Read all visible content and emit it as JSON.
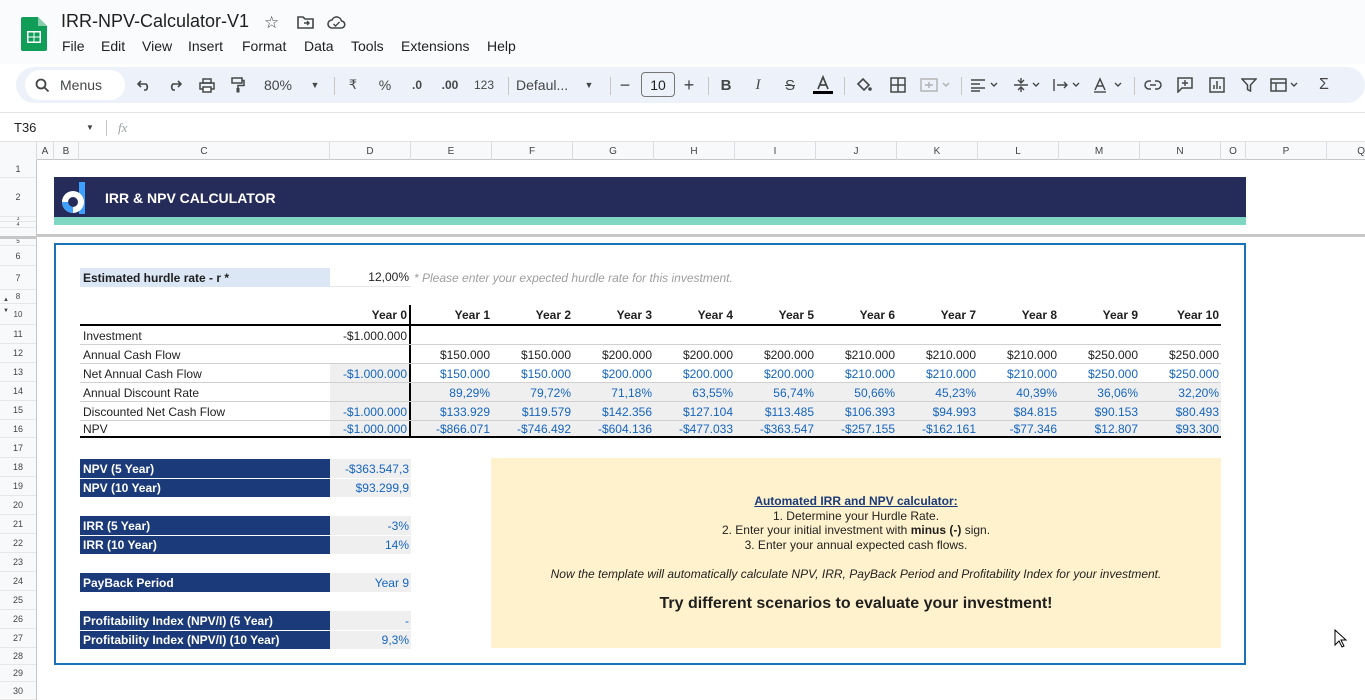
{
  "app": {
    "title": "IRR-NPV-Calculator-V1",
    "menus": [
      "File",
      "Edit",
      "View",
      "Insert",
      "Format",
      "Data",
      "Tools",
      "Extensions",
      "Help"
    ]
  },
  "toolbar": {
    "search_label": "Menus",
    "zoom": "80%",
    "currency": "₹",
    "percent": "%",
    "dec_less": ".0",
    "dec_more": ".00",
    "format_123": "123",
    "font": "Defaul...",
    "font_size": "10"
  },
  "formula_bar": {
    "cell_ref": "T36",
    "fx": "fx"
  },
  "columns": [
    "A",
    "B",
    "C",
    "D",
    "E",
    "F",
    "G",
    "H",
    "I",
    "J",
    "K",
    "L",
    "M",
    "N",
    "O",
    "P",
    "Q"
  ],
  "rows": [
    "1",
    "2",
    "3",
    "4",
    "5",
    "6",
    "7",
    "8",
    "10",
    "11",
    "12",
    "13",
    "14",
    "15",
    "16",
    "17",
    "18",
    "19",
    "20",
    "21",
    "22",
    "23",
    "24",
    "25",
    "26",
    "27",
    "28",
    "29",
    "30"
  ],
  "header": {
    "title": "IRR & NPV CALCULATOR",
    "colors": {
      "navy": "#262c5a",
      "teal": "#7fd6c2",
      "accent_blue": "#1565c0",
      "label_blue": "#1b3a7a",
      "note_bg": "#fff2cc"
    }
  },
  "hurdle": {
    "label": "Estimated hurdle rate - r *",
    "value": "12,00%",
    "hint": "* Please enter your expected hurdle rate for this investment."
  },
  "table": {
    "years": [
      "Year 0",
      "Year 1",
      "Year 2",
      "Year 3",
      "Year 4",
      "Year 5",
      "Year 6",
      "Year 7",
      "Year 8",
      "Year 9",
      "Year 10"
    ],
    "rows": [
      {
        "label": "Investment",
        "values": [
          "-$1.000.000",
          "",
          "",
          "",
          "",
          "",
          "",
          "",
          "",
          "",
          ""
        ]
      },
      {
        "label": "Annual Cash Flow",
        "values": [
          "",
          "$150.000",
          "$150.000",
          "$200.000",
          "$200.000",
          "$200.000",
          "$210.000",
          "$210.000",
          "$210.000",
          "$250.000",
          "$250.000"
        ]
      },
      {
        "label": "Net Annual Cash Flow",
        "values": [
          "-$1.000.000",
          "$150.000",
          "$150.000",
          "$200.000",
          "$200.000",
          "$200.000",
          "$210.000",
          "$210.000",
          "$210.000",
          "$250.000",
          "$250.000"
        ]
      },
      {
        "label": "Annual Discount Rate",
        "values": [
          "",
          "89,29%",
          "79,72%",
          "71,18%",
          "63,55%",
          "56,74%",
          "50,66%",
          "45,23%",
          "40,39%",
          "36,06%",
          "32,20%"
        ]
      },
      {
        "label": "Discounted Net Cash Flow",
        "values": [
          "-$1.000.000",
          "$133.929",
          "$119.579",
          "$142.356",
          "$127.104",
          "$113.485",
          "$106.393",
          "$94.993",
          "$84.815",
          "$90.153",
          "$80.493"
        ]
      },
      {
        "label": "NPV",
        "values": [
          "-$1.000.000",
          "-$866.071",
          "-$746.492",
          "-$604.136",
          "-$477.033",
          "-$363.547",
          "-$257.155",
          "-$162.161",
          "-$77.346",
          "$12.807",
          "$93.300"
        ]
      }
    ]
  },
  "summary": [
    {
      "label": "NPV (5 Year)",
      "value": "-$363.547,3"
    },
    {
      "label": "NPV (10 Year)",
      "value": "$93.299,9"
    },
    {
      "label": "IRR (5 Year)",
      "value": "-3%"
    },
    {
      "label": "IRR (10 Year)",
      "value": "14%"
    },
    {
      "label": "PayBack Period",
      "value": "Year 9"
    },
    {
      "label": "Profitability Index (NPV/I) (5 Year)",
      "value": "-"
    },
    {
      "label": "Profitability Index (NPV/I) (10 Year)",
      "value": "9,3%"
    }
  ],
  "note": {
    "heading": "Automated IRR and NPV calculator:",
    "step1": "1. Determine your Hurdle Rate.",
    "step2_a": "2. Enter your initial investment with ",
    "step2_b": "minus (-)",
    "step2_c": " sign.",
    "step3": "3. Enter your annual expected cash flows.",
    "auto": "Now the template will automatically calculate NPV, IRR, PayBack Period and Profitability Index for your investment.",
    "cta": "Try different scenarios to evaluate your investment!"
  }
}
